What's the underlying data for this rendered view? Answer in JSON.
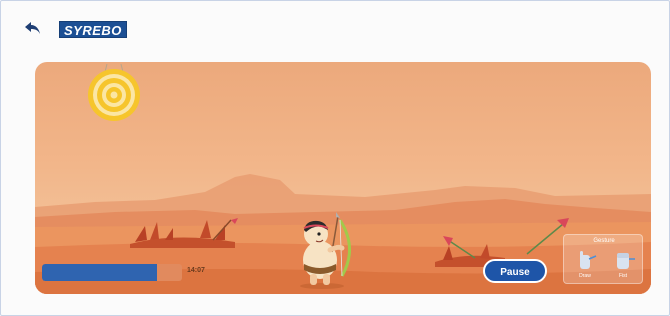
{
  "header": {
    "logo_text": "SYREBO",
    "back_icon": "back-arrow-icon"
  },
  "game": {
    "timer": "14:07",
    "progress_fraction": 0.82,
    "pause_label": "Pause",
    "gesture_panel": {
      "title": "Gesture",
      "items": [
        {
          "label": "Draw",
          "icon": "hand-draw-icon"
        },
        {
          "label": "Fist",
          "icon": "hand-fist-icon"
        }
      ]
    }
  },
  "colors": {
    "accent": "#1e55a8",
    "progress_fill": "#2f64b0",
    "sky": "#f2b68a",
    "target_yellow": "#f6c52c"
  }
}
